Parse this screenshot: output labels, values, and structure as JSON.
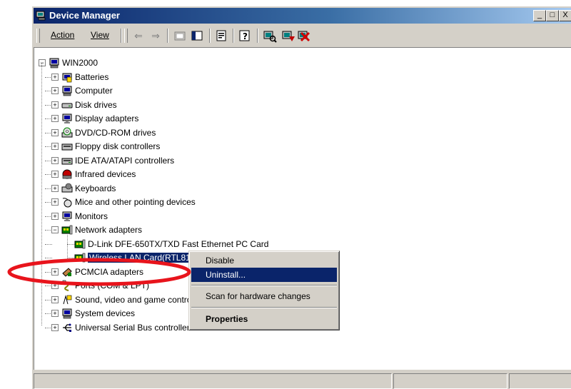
{
  "window": {
    "title": "Device Manager",
    "min_label": "_",
    "max_label": "□",
    "close_label": "X"
  },
  "menu": {
    "action": "Action",
    "view": "View"
  },
  "tree": {
    "root": "WIN2000",
    "categories": [
      {
        "label": "Batteries",
        "icon": "battery-icon"
      },
      {
        "label": "Computer",
        "icon": "computer-icon"
      },
      {
        "label": "Disk drives",
        "icon": "disk-drive-icon"
      },
      {
        "label": "Display adapters",
        "icon": "monitor-icon"
      },
      {
        "label": "DVD/CD-ROM drives",
        "icon": "cdrom-icon"
      },
      {
        "label": "Floppy disk controllers",
        "icon": "floppy-controller-icon"
      },
      {
        "label": "IDE ATA/ATAPI controllers",
        "icon": "ide-controller-icon"
      },
      {
        "label": "Infrared devices",
        "icon": "infrared-icon"
      },
      {
        "label": "Keyboards",
        "icon": "keyboard-icon"
      },
      {
        "label": "Mice and other pointing devices",
        "icon": "mouse-icon"
      },
      {
        "label": "Monitors",
        "icon": "monitor-icon"
      },
      {
        "label": "Network adapters",
        "icon": "network-card-icon"
      }
    ],
    "network_children": [
      "D-Link DFE-650TX/TXD Fast Ethernet PC Card",
      "Wireless LAN Card(RTL8180)"
    ],
    "after": [
      {
        "label": "PCMCIA adapters",
        "icon": "pcmcia-icon"
      },
      {
        "label": "Ports (COM & LPT)",
        "icon": "port-icon"
      },
      {
        "label": "Sound, video and game controllers",
        "icon": "sound-icon"
      },
      {
        "label": "System devices",
        "icon": "computer-icon"
      },
      {
        "label": "Universal Serial Bus controllers",
        "icon": "usb-icon"
      }
    ]
  },
  "context_menu": {
    "disable": "Disable",
    "uninstall": "Uninstall...",
    "scan": "Scan for hardware changes",
    "properties": "Properties"
  },
  "colors": {
    "selection": "#0a246a",
    "annotation": "#e8141c"
  }
}
